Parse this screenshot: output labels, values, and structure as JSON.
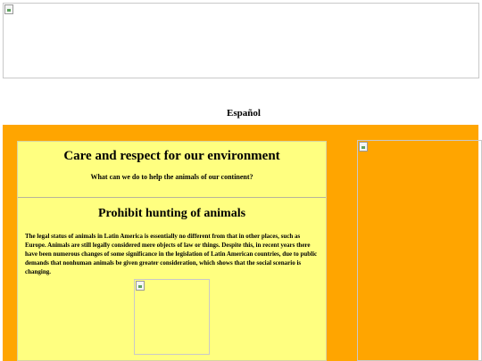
{
  "header": {
    "language_link": "Español"
  },
  "main": {
    "title": "Care and respect for our environment",
    "subtitle": "What can we do to help the animals of our continent?",
    "article": {
      "heading": "Prohibit hunting of animals",
      "body": "The legal status of animals in Latin America is essentially no different from that in other places, such as Europe. Animals are still legally considered mere objects of law or things. Despite this, in recent years there have been numerous changes of some significance in the legislation of Latin American countries, due to public demands that nonhuman animals be given greater consideration, which shows that the social scenario is changing."
    }
  },
  "colors": {
    "page_background": "#ffffff",
    "section_background": "#ffa500",
    "panel_background": "#ffff80"
  },
  "icons": {
    "broken_image": "broken-image-icon"
  }
}
